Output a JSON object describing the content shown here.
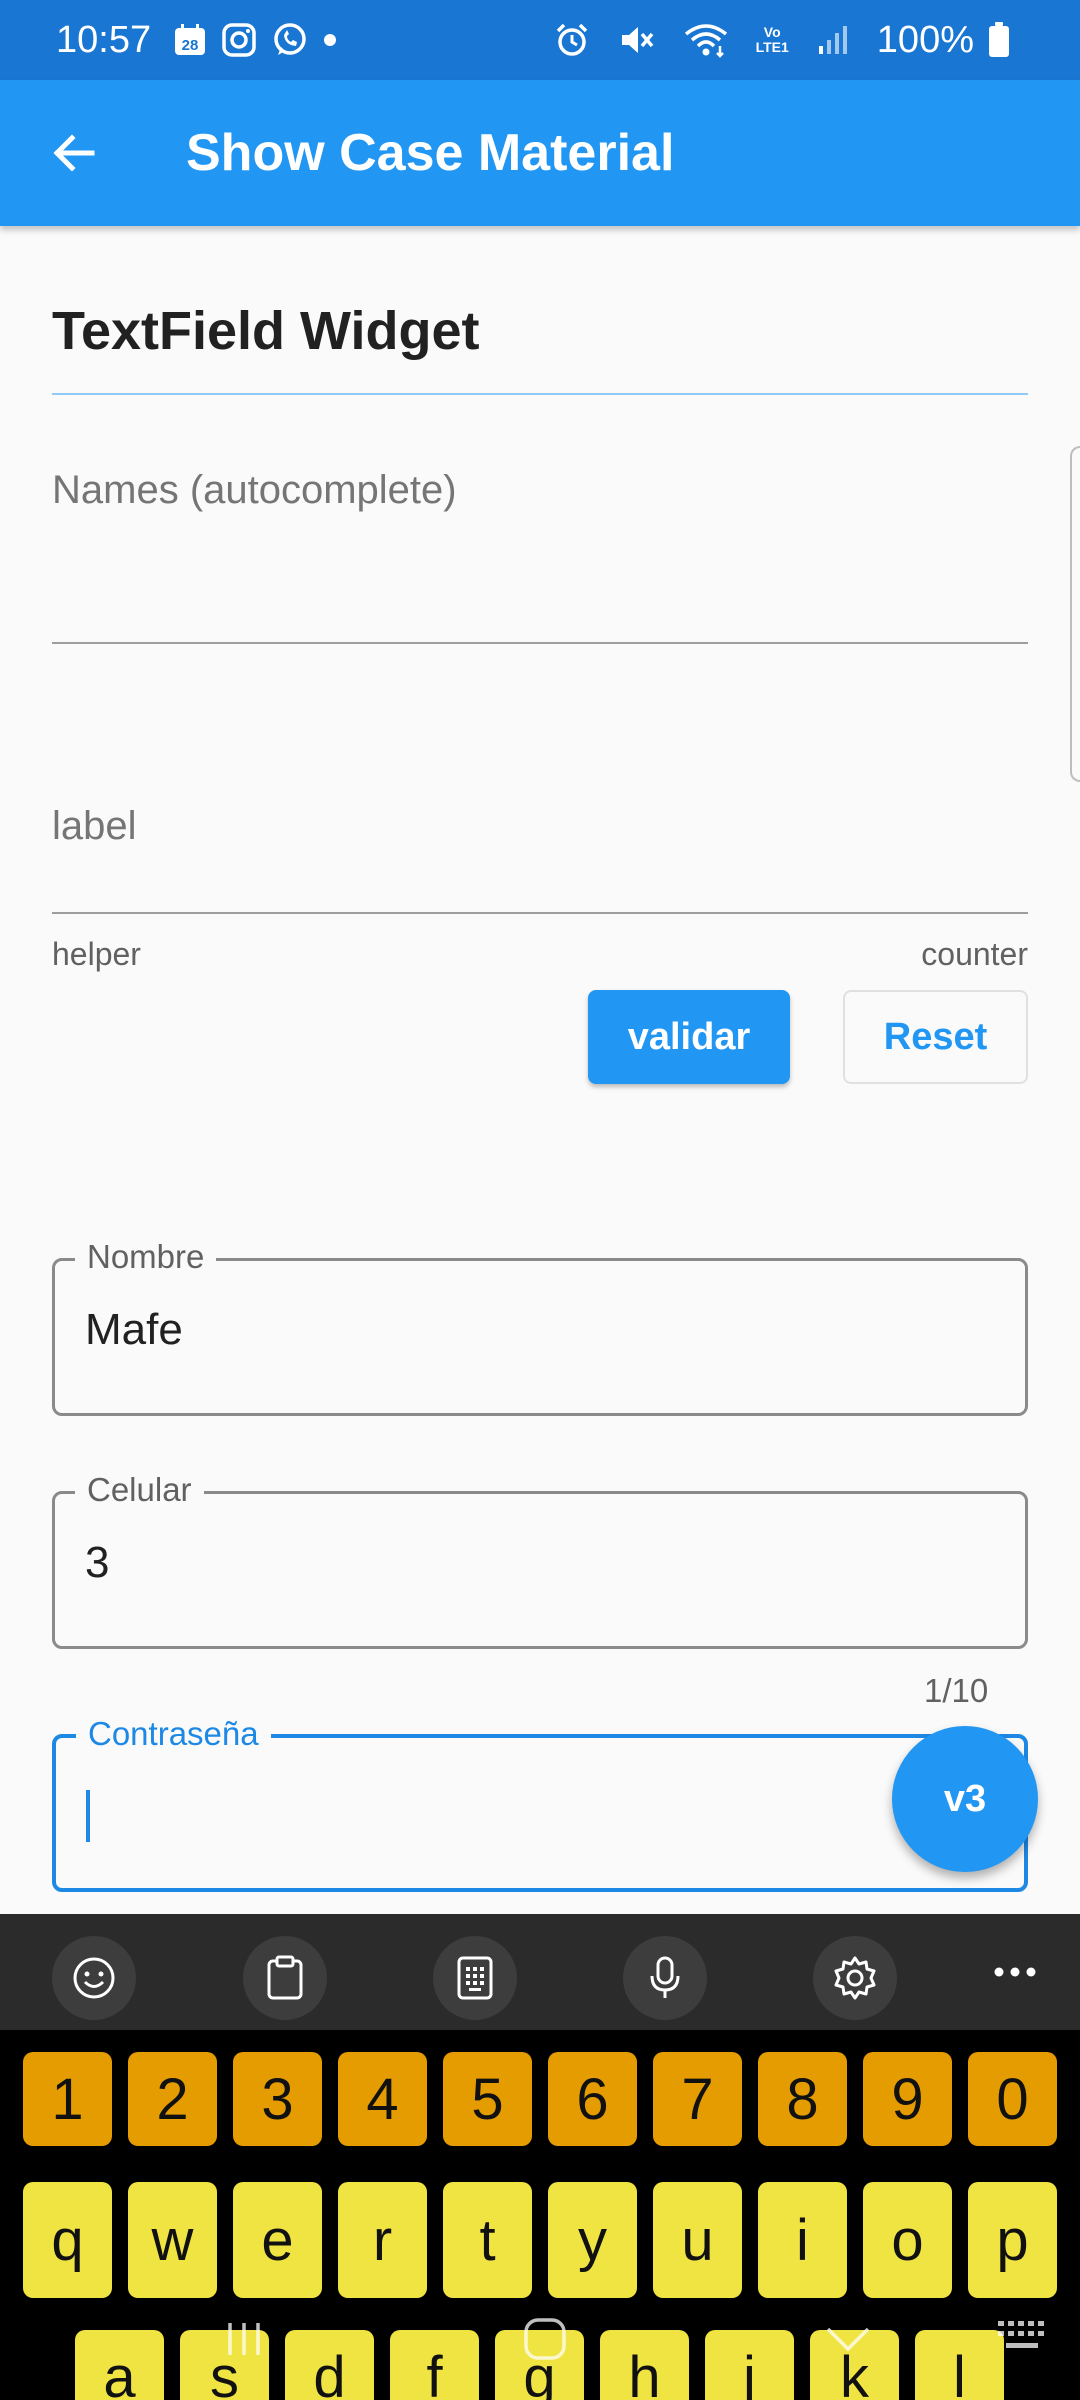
{
  "status_bar": {
    "time": "10:57",
    "calendar_day": "28",
    "battery": "100%",
    "lte": "LTE1"
  },
  "app_bar": {
    "title": "Show Case Material"
  },
  "section": {
    "title": "TextField Widget"
  },
  "fields": {
    "names": {
      "label": "Names (autocomplete)"
    },
    "label_field": {
      "label": "label",
      "helper": "helper",
      "counter": "counter"
    },
    "nombre": {
      "label": "Nombre",
      "value": "Mafe"
    },
    "celular": {
      "label": "Celular",
      "value": "3",
      "counter": "1/10"
    },
    "password": {
      "label": "Contraseña",
      "value": ""
    }
  },
  "buttons": {
    "validate": "validar",
    "reset": "Reset",
    "fab": "v3"
  },
  "keyboard": {
    "numbers": [
      "1",
      "2",
      "3",
      "4",
      "5",
      "6",
      "7",
      "8",
      "9",
      "0"
    ],
    "row1": [
      "q",
      "w",
      "e",
      "r",
      "t",
      "y",
      "u",
      "i",
      "o",
      "p"
    ],
    "row2": [
      "a",
      "s",
      "d",
      "f",
      "g",
      "h",
      "j",
      "k",
      "l"
    ],
    "toolbar_icons": [
      "emoji-icon",
      "clipboard-icon",
      "keypad-icon",
      "microphone-icon",
      "settings-icon",
      "more-icon"
    ]
  },
  "colors": {
    "status_bar": "#1976d2",
    "app_bar": "#2196f3",
    "accent": "#2196f3",
    "focused": "#1e88e5",
    "key_number": "#e59c00",
    "key_letter": "#f0e442"
  }
}
